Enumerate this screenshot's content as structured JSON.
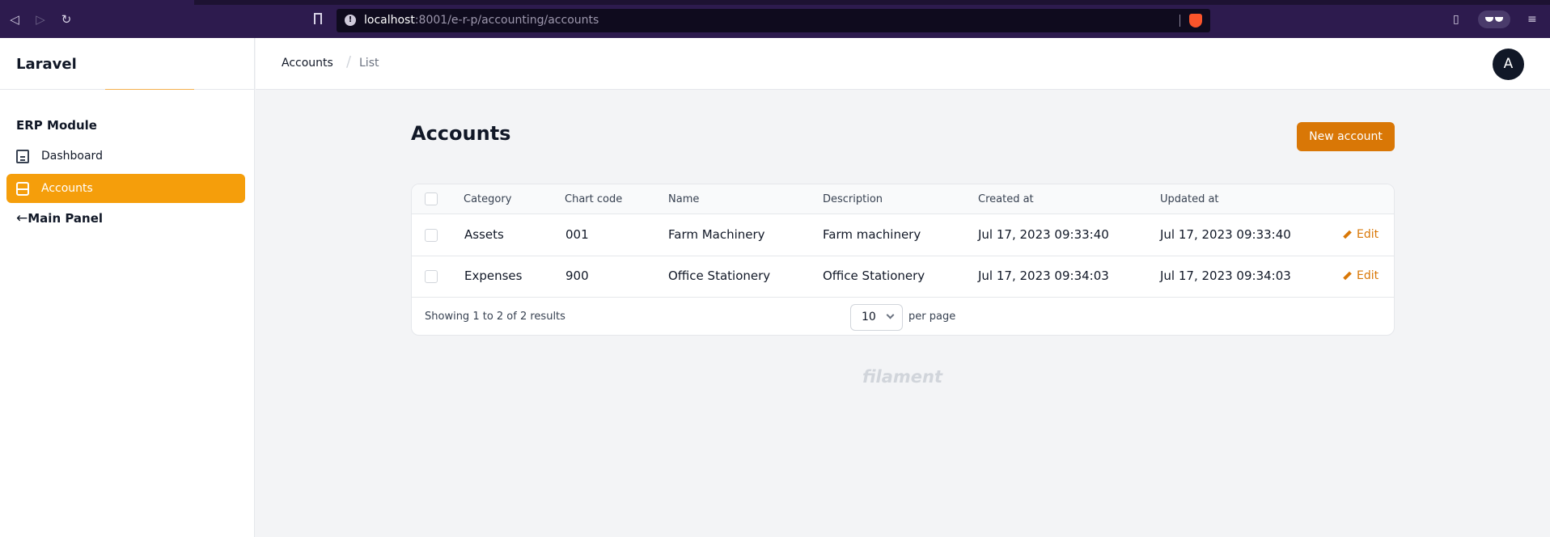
{
  "browser": {
    "url_host": "localhost",
    "url_rest": ":8001/e-r-p/accounting/accounts"
  },
  "sidebar": {
    "brand": "Laravel",
    "group_label": "ERP Module",
    "items": [
      {
        "label": "Dashboard",
        "icon": "document-icon",
        "active": false
      },
      {
        "label": "Accounts",
        "icon": "inbox-stack-icon",
        "active": true
      }
    ],
    "main_panel": {
      "arrow": "←",
      "label": "Main Panel"
    }
  },
  "header": {
    "breadcrumbs": [
      "Accounts",
      "List"
    ],
    "breadcrumb_separator": "/",
    "avatar_initial": "A"
  },
  "main": {
    "title": "Accounts",
    "new_button": "New account",
    "table": {
      "columns": [
        "Category",
        "Chart code",
        "Name",
        "Description",
        "Created at",
        "Updated at"
      ],
      "rows": [
        {
          "category": "Assets",
          "chart_code": "001",
          "name": "Farm Machinery",
          "description": "Farm machinery",
          "created_at": "Jul 17, 2023 09:33:40",
          "updated_at": "Jul 17, 2023 09:33:40",
          "action": "Edit"
        },
        {
          "category": "Expenses",
          "chart_code": "900",
          "name": "Office Stationery",
          "description": "Office Stationery",
          "created_at": "Jul 17, 2023 09:34:03",
          "updated_at": "Jul 17, 2023 09:34:03",
          "action": "Edit"
        }
      ],
      "showing_text": "Showing 1 to 2 of 2 results",
      "per_page_value": "10",
      "per_page_label": "per page"
    },
    "footer_brand": "filament"
  },
  "colors": {
    "accent": "#f59e0b",
    "button": "#d97706",
    "browser_bar": "#2d1b4e"
  }
}
